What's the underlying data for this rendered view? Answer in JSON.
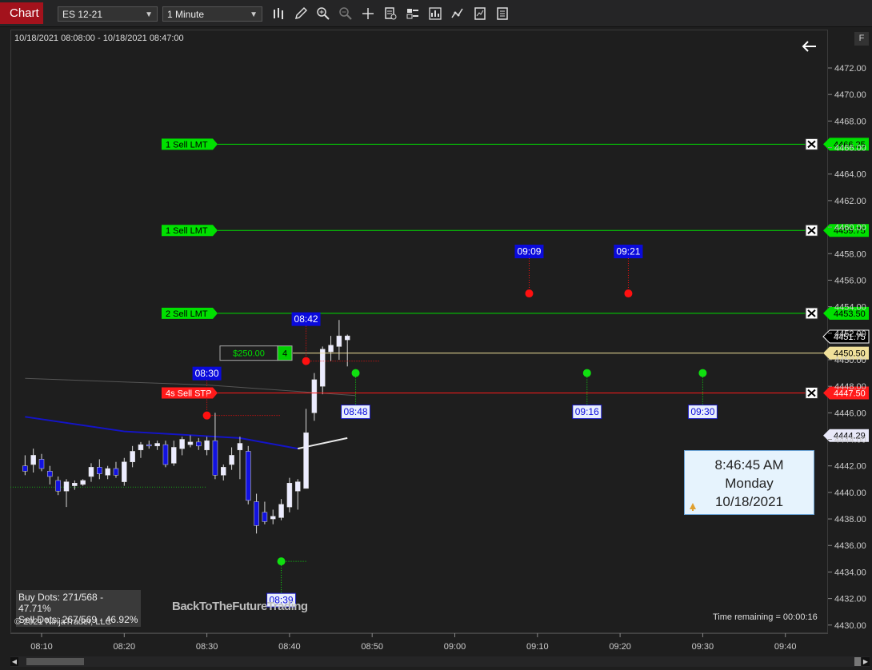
{
  "toolbar": {
    "tab_label": "Chart",
    "instrument": "ES 12-21",
    "interval": "1 Minute",
    "icons": [
      "bars-type-icon",
      "draw-pencil-icon",
      "zoom-in-icon",
      "zoom-out-icon",
      "crosshair-icon",
      "properties-icon",
      "data-box-icon",
      "strategies-icon",
      "indicators-icon",
      "templates-icon",
      "share-icon"
    ]
  },
  "chart": {
    "range_label": "10/18/2021 08:08:00 - 10/18/2021 08:47:00",
    "f_button": "F",
    "copyright": "© 2021 NinjaTrader, LLC",
    "watermark": "BackToTheFutureTrading",
    "time_remaining": "Time remaining = 00:00:16",
    "stats": {
      "buy": "Buy Dots: 271/568 - 47.71%",
      "sell": "Sell Dots: 267/569 - 46.92%"
    },
    "time_info": {
      "time": "8:46:45 AM",
      "day": "Monday",
      "date": "10/18/2021"
    }
  },
  "orders": [
    {
      "label": "1  Sell LMT",
      "price_label": "4466.25",
      "price": 4466.25,
      "color": "#00e000",
      "type": "limit"
    },
    {
      "label": "1  Sell LMT",
      "price_label": "4459.75",
      "price": 4459.75,
      "color": "#00e000",
      "type": "limit"
    },
    {
      "label": "2  Sell LMT",
      "price_label": "4453.50",
      "price": 4453.5,
      "color": "#00e000",
      "type": "limit"
    },
    {
      "label": "4s  Sell STP",
      "price_label": "4447.50",
      "price": 4447.5,
      "color": "#ff1a1a",
      "type": "stop"
    }
  ],
  "position": {
    "pnl": "$250.00",
    "qty": "4",
    "price_label": "4450.50",
    "price": 4450.5
  },
  "markers": {
    "last_price": {
      "label": "4451.75",
      "price": 4451.75
    },
    "indicator_price": {
      "label": "4444.29",
      "price": 4444.29
    }
  },
  "dots": [
    {
      "label": "09:09",
      "time": "09:09",
      "price": 4455.0,
      "color": "red",
      "label_pos": "above"
    },
    {
      "label": "09:21",
      "time": "09:21",
      "price": 4455.0,
      "color": "red",
      "label_pos": "above"
    },
    {
      "label": "08:42",
      "time": "08:42",
      "price": 4449.9,
      "color": "red",
      "label_pos": "above"
    },
    {
      "label": "08:30",
      "time": "08:30",
      "price": 4445.8,
      "color": "red",
      "label_pos": "above"
    },
    {
      "label": "08:48",
      "time": "08:48",
      "price": 4449.0,
      "color": "green",
      "label_pos": "below"
    },
    {
      "label": "09:16",
      "time": "09:16",
      "price": 4449.0,
      "color": "green",
      "label_pos": "below"
    },
    {
      "label": "09:30",
      "time": "09:30",
      "price": 4449.0,
      "color": "green",
      "label_pos": "below"
    },
    {
      "label": "08:39",
      "time": "08:39",
      "price": 4434.8,
      "color": "green",
      "label_pos": "below"
    }
  ],
  "chart_data": {
    "type": "candlestick",
    "instrument": "ES 12-21",
    "interval": "1 Minute",
    "price_axis": {
      "ylim": [
        4429.5,
        4473.5
      ],
      "ticks": [
        "4472.00",
        "4470.00",
        "4468.00",
        "4466.00",
        "4464.00",
        "4462.00",
        "4460.00",
        "4458.00",
        "4456.00",
        "4454.00",
        "4452.00",
        "4450.00",
        "4448.00",
        "4446.00",
        "4444.00",
        "4442.00",
        "4440.00",
        "4438.00",
        "4436.00",
        "4434.00",
        "4432.00",
        "4430.00"
      ]
    },
    "time_axis": {
      "ticks": [
        "08:10",
        "08:20",
        "08:30",
        "08:40",
        "08:50",
        "09:00",
        "09:10",
        "09:20",
        "09:30",
        "09:40"
      ]
    },
    "candles": [
      {
        "t": "08:08",
        "o": 4442.0,
        "h": 4442.8,
        "l": 4441.3,
        "c": 4441.6
      },
      {
        "t": "08:09",
        "o": 4442.1,
        "h": 4443.3,
        "l": 4441.5,
        "c": 4442.8
      },
      {
        "t": "08:10",
        "o": 4442.5,
        "h": 4442.9,
        "l": 4441.6,
        "c": 4441.8
      },
      {
        "t": "08:11",
        "o": 4441.6,
        "h": 4442.0,
        "l": 4440.6,
        "c": 4441.2
      },
      {
        "t": "08:12",
        "o": 4440.9,
        "h": 4441.2,
        "l": 4439.8,
        "c": 4440.1
      },
      {
        "t": "08:13",
        "o": 4440.1,
        "h": 4441.0,
        "l": 4438.9,
        "c": 4440.8
      },
      {
        "t": "08:14",
        "o": 4440.5,
        "h": 4440.9,
        "l": 4440.2,
        "c": 4440.7
      },
      {
        "t": "08:15",
        "o": 4440.6,
        "h": 4441.0,
        "l": 4440.5,
        "c": 4440.9
      },
      {
        "t": "08:16",
        "o": 4441.2,
        "h": 4442.2,
        "l": 4440.8,
        "c": 4441.9
      },
      {
        "t": "08:17",
        "o": 4441.9,
        "h": 4442.5,
        "l": 4441.0,
        "c": 4441.4
      },
      {
        "t": "08:18",
        "o": 4441.3,
        "h": 4442.0,
        "l": 4441.0,
        "c": 4441.8
      },
      {
        "t": "08:19",
        "o": 4441.8,
        "h": 4442.3,
        "l": 4441.1,
        "c": 4441.3
      },
      {
        "t": "08:20",
        "o": 4440.8,
        "h": 4442.6,
        "l": 4440.5,
        "c": 4442.3
      },
      {
        "t": "08:21",
        "o": 4442.3,
        "h": 4443.5,
        "l": 4441.9,
        "c": 4443.1
      },
      {
        "t": "08:22",
        "o": 4443.2,
        "h": 4443.8,
        "l": 4442.6,
        "c": 4443.6
      },
      {
        "t": "08:23",
        "o": 4443.6,
        "h": 4443.9,
        "l": 4443.3,
        "c": 4443.5
      },
      {
        "t": "08:24",
        "o": 4443.5,
        "h": 4443.9,
        "l": 4443.2,
        "c": 4443.7
      },
      {
        "t": "08:25",
        "o": 4443.6,
        "h": 4443.9,
        "l": 4441.9,
        "c": 4442.1
      },
      {
        "t": "08:26",
        "o": 4442.2,
        "h": 4443.9,
        "l": 4442.0,
        "c": 4443.4
      },
      {
        "t": "08:27",
        "o": 4443.3,
        "h": 4444.2,
        "l": 4442.8,
        "c": 4444.0
      },
      {
        "t": "08:28",
        "o": 4443.6,
        "h": 4444.3,
        "l": 4443.4,
        "c": 4443.8
      },
      {
        "t": "08:29",
        "o": 4443.8,
        "h": 4444.1,
        "l": 4443.2,
        "c": 4443.5
      },
      {
        "t": "08:30",
        "o": 4443.2,
        "h": 4444.2,
        "l": 4442.8,
        "c": 4443.9
      },
      {
        "t": "08:31",
        "o": 4443.9,
        "h": 4446.0,
        "l": 4441.0,
        "c": 4441.3
      },
      {
        "t": "08:32",
        "o": 4441.3,
        "h": 4442.1,
        "l": 4440.9,
        "c": 4441.9
      },
      {
        "t": "08:33",
        "o": 4442.1,
        "h": 4443.4,
        "l": 4441.7,
        "c": 4442.8
      },
      {
        "t": "08:34",
        "o": 4443.2,
        "h": 4444.2,
        "l": 4441.0,
        "c": 4443.7
      },
      {
        "t": "08:35",
        "o": 4443.1,
        "h": 4443.5,
        "l": 4439.1,
        "c": 4439.4
      },
      {
        "t": "08:36",
        "o": 4439.3,
        "h": 4439.9,
        "l": 4436.9,
        "c": 4437.5
      },
      {
        "t": "08:37",
        "o": 4438.5,
        "h": 4439.3,
        "l": 4437.6,
        "c": 4437.8
      },
      {
        "t": "08:38",
        "o": 4438.0,
        "h": 4438.7,
        "l": 4437.6,
        "c": 4438.2
      },
      {
        "t": "08:39",
        "o": 4438.1,
        "h": 4439.5,
        "l": 4437.9,
        "c": 4439.1
      },
      {
        "t": "08:40",
        "o": 4438.9,
        "h": 4441.1,
        "l": 4438.5,
        "c": 4440.7
      },
      {
        "t": "08:41",
        "o": 4440.1,
        "h": 4441.0,
        "l": 4438.7,
        "c": 4440.8
      },
      {
        "t": "08:42",
        "o": 4440.3,
        "h": 4446.3,
        "l": 4440.3,
        "c": 4444.5
      },
      {
        "t": "08:43",
        "o": 4446.0,
        "h": 4449.0,
        "l": 4445.4,
        "c": 4448.5
      },
      {
        "t": "08:44",
        "o": 4448.0,
        "h": 4451.0,
        "l": 4447.4,
        "c": 4450.8
      },
      {
        "t": "08:45",
        "o": 4450.6,
        "h": 4451.8,
        "l": 4449.9,
        "c": 4451.1
      },
      {
        "t": "08:46",
        "o": 4451.0,
        "h": 4453.0,
        "l": 4450.0,
        "c": 4451.8
      },
      {
        "t": "08:47",
        "o": 4451.5,
        "h": 4451.9,
        "l": 4449.5,
        "c": 4451.8
      }
    ],
    "overlays": [
      {
        "name": "blue-line",
        "color": "#1414c8",
        "points": [
          [
            "08:08",
            4445.7
          ],
          [
            "08:20",
            4444.6
          ],
          [
            "08:34",
            4444.1
          ],
          [
            "08:41",
            4443.3
          ]
        ]
      },
      {
        "name": "white-line",
        "color": "#e8e8e8",
        "points": [
          [
            "08:41",
            4443.3
          ],
          [
            "08:47",
            4444.1
          ]
        ]
      },
      {
        "name": "gray-line",
        "color": "#555555",
        "points": [
          [
            "08:08",
            4448.6
          ],
          [
            "08:30",
            4448.1
          ],
          [
            "08:48",
            4447.3
          ]
        ]
      }
    ]
  }
}
